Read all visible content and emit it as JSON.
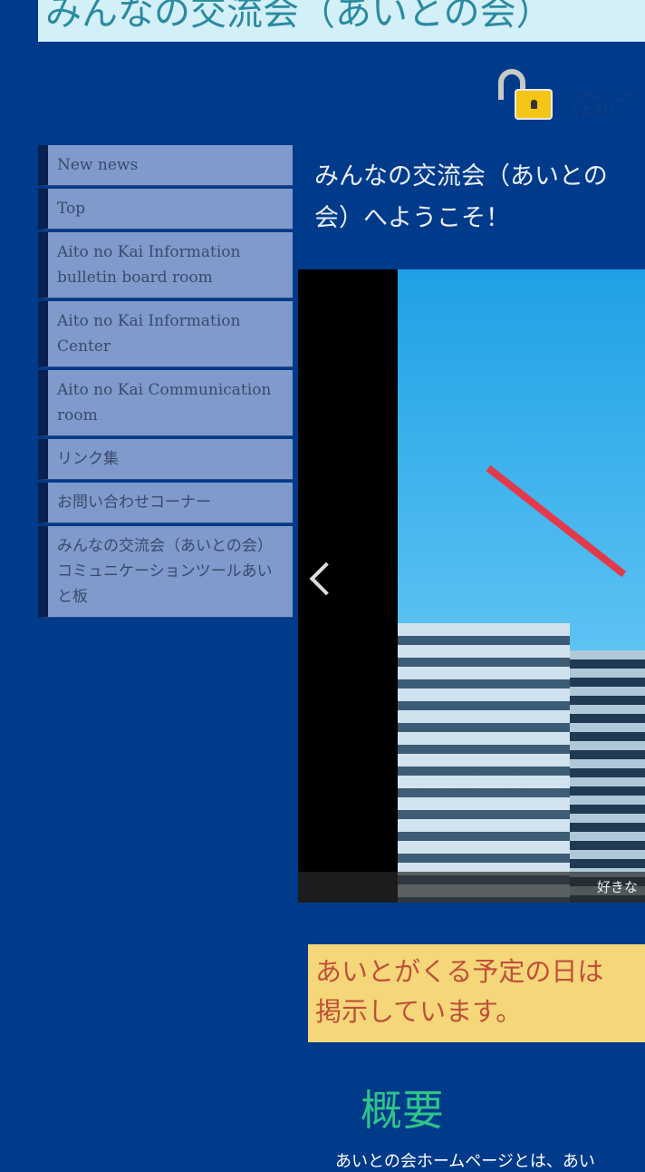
{
  "header": {
    "site_title": "みんなの交流会（あいとの会）",
    "login_label": "ログインしてください"
  },
  "sidebar": {
    "items": [
      {
        "label": "New news"
      },
      {
        "label": "Top"
      },
      {
        "label": "Aito no Kai Information bulletin board room"
      },
      {
        "label": "Aito no Kai Information Center"
      },
      {
        "label": "Aito no Kai Communication room"
      },
      {
        "label": "リンク集"
      },
      {
        "label": "お問い合わせコーナー"
      },
      {
        "label": "みんなの交流会（あいとの会）コミュニケーションツールあいと板"
      }
    ]
  },
  "main": {
    "heading": "みんなの交流会（あいとの会）へようこそ！",
    "slider": {
      "caption": "好きな"
    },
    "notice": "あいとがくる予定の日は\n掲示しています。",
    "notice_line1": "あいとがくる予定の日は",
    "notice_line2": "掲示しています。",
    "section_title": "概要",
    "section_text": "あいとの会ホームページとは、あい"
  },
  "colors": {
    "background": "#003a8a",
    "nav_bg": "#7f9acb",
    "notice_bg": "#f5d77a",
    "notice_text": "#c0503a",
    "section_title": "#2ec48a"
  }
}
